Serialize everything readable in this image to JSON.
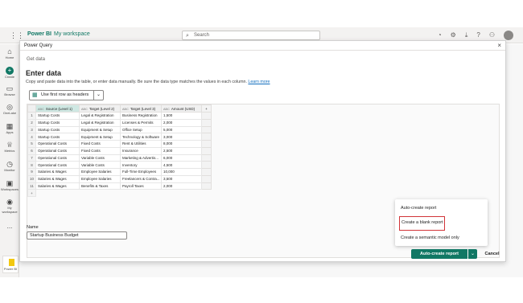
{
  "app": {
    "brand": "Power BI",
    "workspace": "My workspace",
    "search_placeholder": "Search"
  },
  "rail": [
    {
      "label": "Home",
      "icon": "home-icon",
      "glyph": "⌂"
    },
    {
      "label": "Create",
      "icon": "plus-icon",
      "glyph": "+"
    },
    {
      "label": "Browse",
      "icon": "folder-icon",
      "glyph": "▭"
    },
    {
      "label": "OneLake",
      "icon": "onelake-icon",
      "glyph": "◎"
    },
    {
      "label": "Apps",
      "icon": "apps-icon",
      "glyph": "▦"
    },
    {
      "label": "Metrics",
      "icon": "trophy-icon",
      "glyph": "♕"
    },
    {
      "label": "Monitor",
      "icon": "monitor-icon",
      "glyph": "◷"
    },
    {
      "label": "Workspaces",
      "icon": "workspaces-icon",
      "glyph": "▣"
    },
    {
      "label": "My workspace",
      "icon": "my-workspace-icon",
      "glyph": "◉"
    }
  ],
  "rail_more": "...",
  "rail_badge": "Power BI",
  "dialog": {
    "title": "Power Query",
    "breadcrumb": "Get data",
    "heading": "Enter data",
    "description": "Copy and paste data into the table, or enter data manually. Be sure the data type matches the values in each column.",
    "learn_more": "Learn more",
    "headers_button": "Use first row as headers",
    "name_label": "Name",
    "name_value": "Startup Business Budget",
    "primary_button": "Auto-create report",
    "cancel_button": "Cancel"
  },
  "table": {
    "columns": [
      {
        "type": "ABC",
        "name": "Source (Level 1)"
      },
      {
        "type": "ABC",
        "name": "Target (Level 2)"
      },
      {
        "type": "ABC",
        "name": "Target (Level 3)"
      },
      {
        "type": "ABC",
        "name": "Amount (USD)"
      }
    ],
    "rows": [
      [
        "1",
        "Startup Costs",
        "Legal & Registration",
        "Business Registration",
        "1,500"
      ],
      [
        "2",
        "Startup Costs",
        "Legal & Registration",
        "Licenses & Permits",
        "2,000"
      ],
      [
        "3",
        "Startup Costs",
        "Equipment & Setup",
        "Office Setup",
        "5,000"
      ],
      [
        "4",
        "Startup Costs",
        "Equipment & Setup",
        "Technology & Software",
        "3,000"
      ],
      [
        "5",
        "Operational Costs",
        "Fixed Costs",
        "Rent & Utilities",
        "8,000"
      ],
      [
        "6",
        "Operational Costs",
        "Fixed Costs",
        "Insurance",
        "2,500"
      ],
      [
        "7",
        "Operational Costs",
        "Variable Costs",
        "Marketing & Advertis...",
        "6,000"
      ],
      [
        "8",
        "Operational Costs",
        "Variable Costs",
        "Inventory",
        "4,500"
      ],
      [
        "9",
        "Salaries & Wages",
        "Employee Salaries",
        "Full-Time Employees",
        "10,000"
      ],
      [
        "10",
        "Salaries & Wages",
        "Employee Salaries",
        "Freelancers & Contra...",
        "3,500"
      ],
      [
        "11",
        "Salaries & Wages",
        "Benefits & Taxes",
        "Payroll Taxes",
        "2,000"
      ]
    ],
    "add_row": "+",
    "add_col": "+"
  },
  "menu": [
    "Auto-create report",
    "Create a blank report",
    "Create a semantic model only"
  ]
}
